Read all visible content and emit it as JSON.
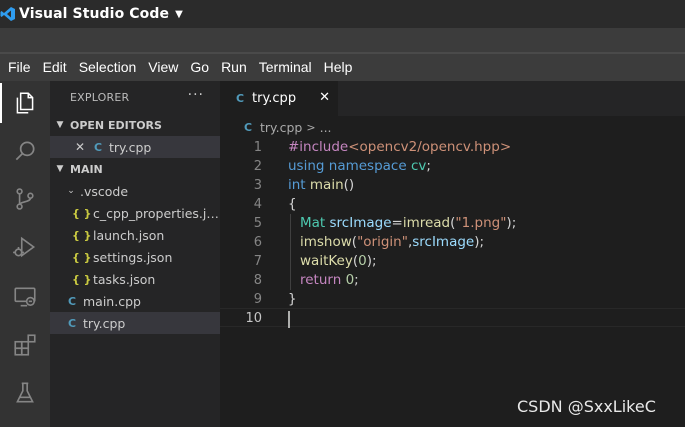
{
  "os_bar": {
    "app_name": "Visual Studio Code",
    "dropdown_icon": "caret-down-icon",
    "logo": "vscode-logo-icon"
  },
  "menu": [
    "File",
    "Edit",
    "Selection",
    "View",
    "Go",
    "Run",
    "Terminal",
    "Help"
  ],
  "activity_bar": [
    "explorer-icon",
    "search-icon",
    "source-control-icon",
    "run-debug-icon",
    "remote-explorer-icon",
    "extensions-icon",
    "testing-icon"
  ],
  "sidebar": {
    "title": "EXPLORER",
    "more": "···",
    "open_editors_label": "OPEN EDITORS",
    "open_editors": [
      {
        "name": "try.cpp",
        "icon": "cpp-file-icon"
      }
    ],
    "folder_label": "MAIN",
    "tree": {
      "vscode_folder": ".vscode",
      "vscode_files": [
        "c_cpp_properties.js...",
        "launch.json",
        "settings.json",
        "tasks.json"
      ],
      "files": [
        "main.cpp",
        "try.cpp"
      ]
    },
    "icon_cpp": "C",
    "icon_json": "{ }"
  },
  "tabs": [
    {
      "label": "try.cpp",
      "active": true
    }
  ],
  "breadcrumb": {
    "file": "try.cpp",
    "sep": ">",
    "rest": "..."
  },
  "code": {
    "line_numbers": [
      "1",
      "2",
      "3",
      "4",
      "5",
      "6",
      "7",
      "8",
      "9",
      "10"
    ],
    "l1": {
      "directive": "#include",
      "header": "<opencv2/opencv.hpp>"
    },
    "l2": {
      "kw1": "using",
      "kw2": "namespace",
      "ns": "cv",
      "end": ";"
    },
    "l3": {
      "type": "int",
      "fn": "main",
      "paren": "()"
    },
    "l4": {
      "brace": "{"
    },
    "l5": {
      "type": "Mat",
      "var": "srcImage",
      "eq": "=",
      "fn": "imread",
      "open": "(",
      "str": "\"1.png\"",
      "close": ");"
    },
    "l6": {
      "fn": "imshow",
      "open": "(",
      "str": "\"origin\"",
      "comma": ",",
      "var": "srcImage",
      "close": ");"
    },
    "l7": {
      "fn": "waitKey",
      "open": "(",
      "num": "0",
      "close": ");"
    },
    "l8": {
      "kw": "return",
      "num": "0",
      "end": ";"
    },
    "l9": {
      "brace": "}"
    }
  },
  "watermark": "CSDN @SxxLikeC",
  "colors": {
    "accent": "#007acc",
    "cpp_icon": "#519aba",
    "json_icon": "#cbcb41"
  }
}
